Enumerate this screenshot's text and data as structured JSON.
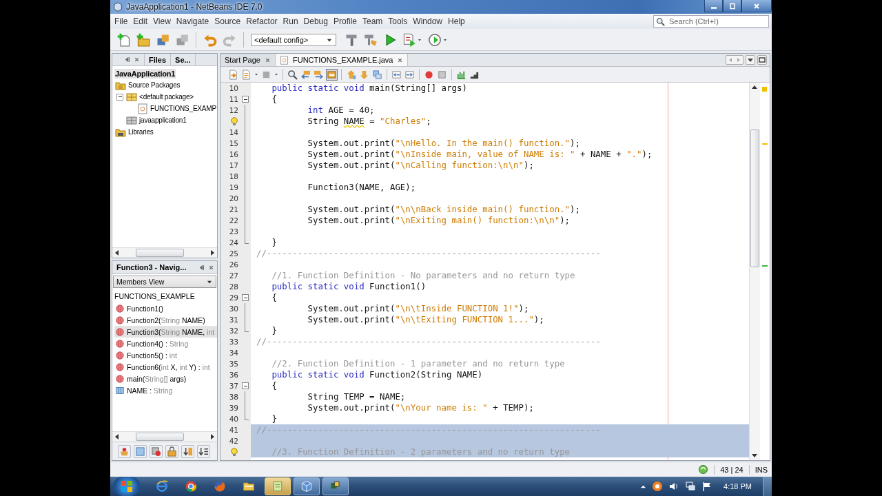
{
  "window": {
    "title": "JavaApplication1 - NetBeans IDE 7.0"
  },
  "menu": [
    "File",
    "Edit",
    "View",
    "Navigate",
    "Source",
    "Refactor",
    "Run",
    "Debug",
    "Profile",
    "Team",
    "Tools",
    "Window",
    "Help"
  ],
  "search": {
    "placeholder": "Search (Ctrl+I)"
  },
  "toolbar": {
    "config": "<default config>"
  },
  "projects": {
    "tabs": [
      {
        "label": "Files",
        "selected": false
      },
      {
        "label": "Se...",
        "selected": false
      }
    ],
    "tree": [
      {
        "label": "JavaApplication1",
        "selected": true,
        "children": [
          {
            "label": "Source Packages",
            "kind": "source-folder",
            "selected": false,
            "children": [
              {
                "label": "<default package>",
                "kind": "package",
                "selected": false,
                "children": [
                  {
                    "label": "FUNCTIONS_EXAMP",
                    "kind": "java-file",
                    "selected": false
                  }
                ]
              },
              {
                "label": "javaapplication1",
                "kind": "empty-package",
                "selected": false
              }
            ]
          },
          {
            "label": "Libraries",
            "kind": "libraries",
            "selected": false
          }
        ]
      }
    ]
  },
  "navigator": {
    "title": "Function3 - Navig...",
    "view": "Members View",
    "class_name": "FUNCTIONS_EXAMPLE",
    "members": [
      {
        "kind": "method",
        "selected": false,
        "parts": [
          {
            "kind": "name",
            "text": "Function1()"
          }
        ]
      },
      {
        "kind": "method",
        "selected": false,
        "parts": [
          {
            "kind": "name",
            "text": "Function2("
          },
          {
            "kind": "type",
            "text": "String"
          },
          {
            "kind": "name",
            "text": " NAME)"
          }
        ]
      },
      {
        "kind": "method",
        "selected": true,
        "parts": [
          {
            "kind": "name",
            "text": "Function3("
          },
          {
            "kind": "type",
            "text": "String"
          },
          {
            "kind": "name",
            "text": " NAME, "
          },
          {
            "kind": "type",
            "text": "int"
          }
        ]
      },
      {
        "kind": "method",
        "selected": false,
        "parts": [
          {
            "kind": "name",
            "text": "Function4() : "
          },
          {
            "kind": "type",
            "text": "String"
          }
        ]
      },
      {
        "kind": "method",
        "selected": false,
        "parts": [
          {
            "kind": "name",
            "text": "Function5() : "
          },
          {
            "kind": "type",
            "text": "int"
          }
        ]
      },
      {
        "kind": "method",
        "selected": false,
        "parts": [
          {
            "kind": "name",
            "text": "Function6("
          },
          {
            "kind": "type",
            "text": "int"
          },
          {
            "kind": "name",
            "text": " X, "
          },
          {
            "kind": "type",
            "text": "int"
          },
          {
            "kind": "name",
            "text": " Y) : "
          },
          {
            "kind": "type",
            "text": "int"
          }
        ]
      },
      {
        "kind": "method",
        "selected": false,
        "parts": [
          {
            "kind": "name",
            "text": "main("
          },
          {
            "kind": "type",
            "text": "String[]"
          },
          {
            "kind": "name",
            "text": " args)"
          }
        ]
      },
      {
        "kind": "field",
        "selected": false,
        "parts": [
          {
            "kind": "name",
            "text": "NAME : "
          },
          {
            "kind": "type",
            "text": "String"
          }
        ]
      }
    ]
  },
  "editor": {
    "tabs": [
      {
        "label": "Start Page",
        "selected": false
      },
      {
        "label": "FUNCTIONS_EXAMPLE.java",
        "selected": true
      }
    ],
    "lines": [
      {
        "number": "10",
        "tokens": [
          {
            "kind": "keyword",
            "text": "   public static void"
          },
          {
            "kind": "plain",
            "text": " main(String[] args)"
          }
        ]
      },
      {
        "number": "11",
        "kind": "fold-start",
        "tokens": [
          {
            "kind": "plain",
            "text": "   {"
          }
        ]
      },
      {
        "number": "12",
        "tokens": [
          {
            "kind": "keyword",
            "text": "          int"
          },
          {
            "kind": "plain",
            "text": " AGE = 40;"
          }
        ]
      },
      {
        "kind": "hint",
        "tokens": [
          {
            "kind": "plain",
            "text": "          String "
          },
          {
            "kind": "warning",
            "text": "NAME"
          },
          {
            "kind": "plain",
            "text": " = "
          },
          {
            "kind": "string",
            "text": "\"Charles\""
          },
          {
            "kind": "plain",
            "text": ";"
          }
        ]
      },
      {
        "number": "14"
      },
      {
        "number": "15",
        "tokens": [
          {
            "kind": "plain",
            "text": "          System.out.print("
          },
          {
            "kind": "string",
            "text": "\"\\nHello. In the main() function.\""
          },
          {
            "kind": "plain",
            "text": ");"
          }
        ]
      },
      {
        "number": "16",
        "tokens": [
          {
            "kind": "plain",
            "text": "          System.out.print("
          },
          {
            "kind": "string",
            "text": "\"\\nInside main, value of NAME is: \""
          },
          {
            "kind": "plain",
            "text": " + NAME + "
          },
          {
            "kind": "string",
            "text": "\".\""
          },
          {
            "kind": "plain",
            "text": ");"
          }
        ]
      },
      {
        "number": "17",
        "tokens": [
          {
            "kind": "plain",
            "text": "          System.out.print("
          },
          {
            "kind": "string",
            "text": "\"\\nCalling function:\\n\\n\""
          },
          {
            "kind": "plain",
            "text": ");"
          }
        ]
      },
      {
        "number": "18"
      },
      {
        "number": "19",
        "tokens": [
          {
            "kind": "plain",
            "text": "          Function3(NAME, AGE);"
          }
        ]
      },
      {
        "number": "20"
      },
      {
        "number": "21",
        "tokens": [
          {
            "kind": "plain",
            "text": "          System.out.print("
          },
          {
            "kind": "string",
            "text": "\"\\n\\nBack inside main() function.\""
          },
          {
            "kind": "plain",
            "text": ");"
          }
        ]
      },
      {
        "number": "22",
        "tokens": [
          {
            "kind": "plain",
            "text": "          System.out.print("
          },
          {
            "kind": "string",
            "text": "\"\\nExiting main() function:\\n\\n\""
          },
          {
            "kind": "plain",
            "text": ");"
          }
        ]
      },
      {
        "number": "23"
      },
      {
        "number": "24",
        "kind": "fold-end",
        "tokens": [
          {
            "kind": "plain",
            "text": "   }"
          }
        ]
      },
      {
        "number": "25",
        "tokens": [
          {
            "kind": "comment",
            "text": "//-----------------------------------------------------------------"
          }
        ]
      },
      {
        "number": "26"
      },
      {
        "number": "27",
        "tokens": [
          {
            "kind": "comment",
            "text": "   //1. Function Definition - No parameters and no return type"
          }
        ]
      },
      {
        "number": "28",
        "tokens": [
          {
            "kind": "keyword",
            "text": "   public static void"
          },
          {
            "kind": "plain",
            "text": " Function1()"
          }
        ]
      },
      {
        "number": "29",
        "kind": "fold-start",
        "tokens": [
          {
            "kind": "plain",
            "text": "   {"
          }
        ]
      },
      {
        "number": "30",
        "tokens": [
          {
            "kind": "plain",
            "text": "          System.out.print("
          },
          {
            "kind": "string",
            "text": "\"\\n\\tInside FUNCTION 1!\""
          },
          {
            "kind": "plain",
            "text": ");"
          }
        ]
      },
      {
        "number": "31",
        "tokens": [
          {
            "kind": "plain",
            "text": "          System.out.print("
          },
          {
            "kind": "string",
            "text": "\"\\n\\tExiting FUNCTION 1...\""
          },
          {
            "kind": "plain",
            "text": ");"
          }
        ]
      },
      {
        "number": "32",
        "kind": "fold-end",
        "tokens": [
          {
            "kind": "plain",
            "text": "   }"
          }
        ]
      },
      {
        "number": "33",
        "tokens": [
          {
            "kind": "comment",
            "text": "//-----------------------------------------------------------------"
          }
        ]
      },
      {
        "number": "34"
      },
      {
        "number": "35",
        "tokens": [
          {
            "kind": "comment",
            "text": "   //2. Function Definition - 1 parameter and no return type"
          }
        ]
      },
      {
        "number": "36",
        "tokens": [
          {
            "kind": "keyword",
            "text": "   public static void"
          },
          {
            "kind": "plain",
            "text": " Function2(String NAME)"
          }
        ]
      },
      {
        "number": "37",
        "kind": "fold-start",
        "tokens": [
          {
            "kind": "plain",
            "text": "   {"
          }
        ]
      },
      {
        "number": "38",
        "tokens": [
          {
            "kind": "plain",
            "text": "          String TEMP = NAME;"
          }
        ]
      },
      {
        "number": "39",
        "tokens": [
          {
            "kind": "plain",
            "text": "          System.out.print("
          },
          {
            "kind": "string",
            "text": "\"\\nYour name is: \""
          },
          {
            "kind": "plain",
            "text": " + TEMP);"
          }
        ]
      },
      {
        "number": "40",
        "kind": "fold-end",
        "tokens": [
          {
            "kind": "plain",
            "text": "   }"
          }
        ]
      },
      {
        "number": "41",
        "selected": true,
        "tokens": [
          {
            "kind": "comment",
            "text": "//-----------------------------------------------------------------"
          }
        ]
      },
      {
        "number": "42",
        "selected": true
      },
      {
        "kind": "hint",
        "selected": true,
        "tokens": [
          {
            "kind": "comment",
            "text": "   //3. Function Definition - 2 parameters and no return type"
          }
        ]
      }
    ]
  },
  "status_bar": {
    "position": "43 | 24",
    "mode": "INS"
  },
  "taskbar": {
    "items": [
      {
        "kind": "ie",
        "selected": false,
        "running": false
      },
      {
        "kind": "chrome",
        "selected": false,
        "running": false
      },
      {
        "kind": "firefox",
        "selected": false,
        "running": false
      },
      {
        "kind": "explorer",
        "selected": false,
        "running": false
      },
      {
        "kind": "notes",
        "selected": true,
        "running": true
      },
      {
        "kind": "cube",
        "selected": false,
        "running": true
      },
      {
        "kind": "netbeans",
        "selected": false,
        "running": true
      }
    ],
    "time": "4:18 PM"
  }
}
